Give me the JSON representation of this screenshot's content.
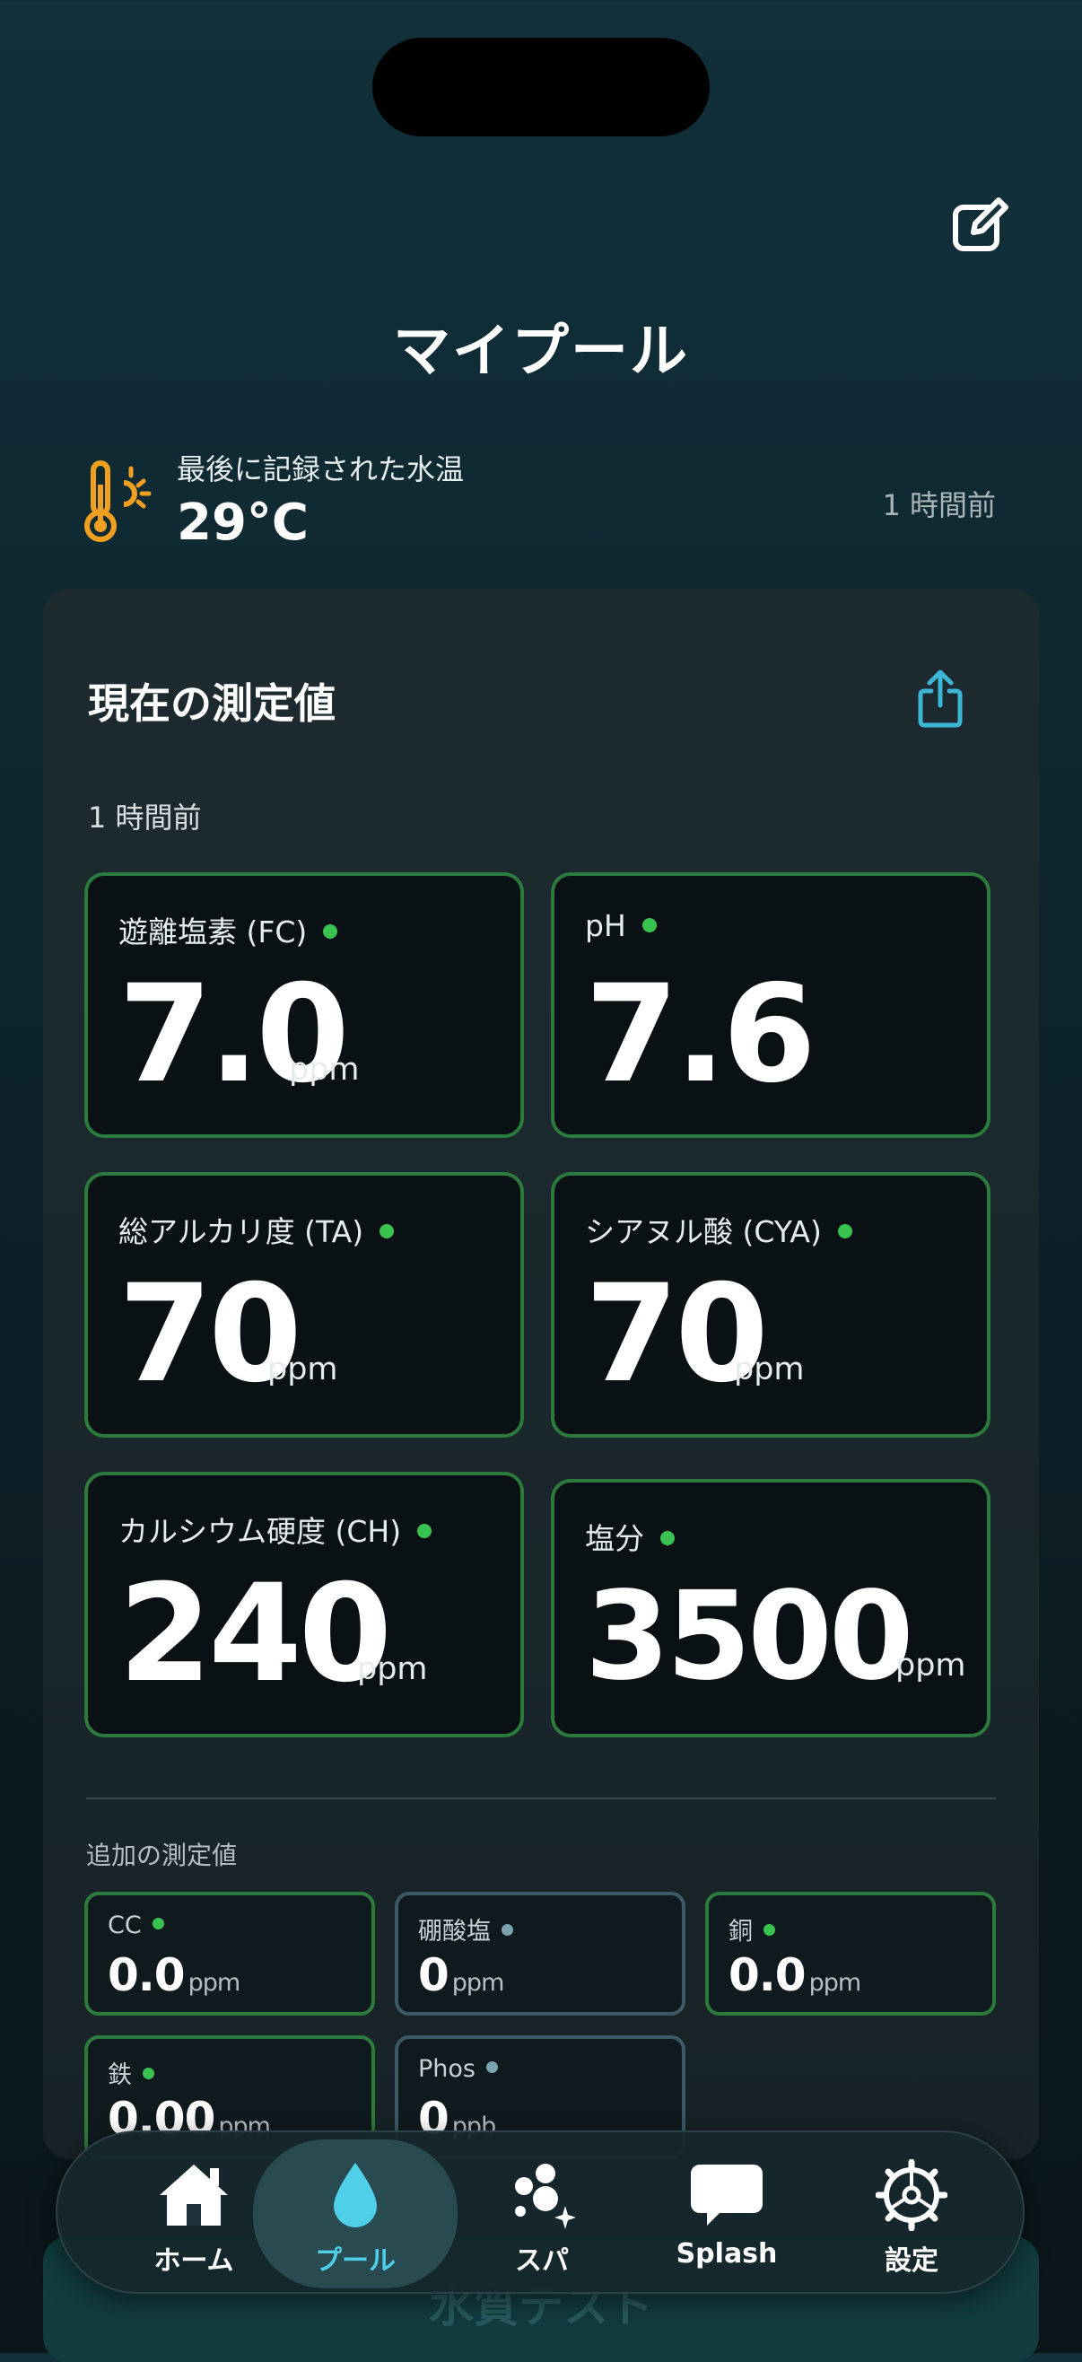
{
  "header": {
    "title": "マイプール"
  },
  "water_temp": {
    "label": "最後に記録された水温",
    "value": "29°C",
    "time": "1 時間前"
  },
  "current": {
    "title": "現在の測定値",
    "time": "1 時間前",
    "metrics": [
      {
        "name": "遊離塩素 (FC)",
        "value": "7.0",
        "unit": "ppm"
      },
      {
        "name": "pH",
        "value": "7.6",
        "unit": ""
      },
      {
        "name": "総アルカリ度 (TA)",
        "value": "70",
        "unit": "ppm"
      },
      {
        "name": "シアヌル酸 (CYA)",
        "value": "70",
        "unit": "ppm"
      },
      {
        "name": "カルシウム硬度 (CH)",
        "value": "240",
        "unit": "ppm"
      },
      {
        "name": "塩分",
        "value": "3500",
        "unit": "ppm"
      }
    ]
  },
  "additional": {
    "title": "追加の測定値",
    "items": [
      {
        "name": "CC",
        "value": "0.0",
        "unit": "ppm"
      },
      {
        "name": "硼酸塩",
        "value": "0",
        "unit": "ppm"
      },
      {
        "name": "銅",
        "value": "0.0",
        "unit": "ppm"
      },
      {
        "name": "鉄",
        "value": "0.00",
        "unit": "ppm"
      },
      {
        "name": "Phos",
        "value": "0",
        "unit": "ppb"
      }
    ]
  },
  "bottom_button": {
    "label": "水質テスト"
  },
  "tabs": [
    {
      "label": "ホーム",
      "icon": "home-icon"
    },
    {
      "label": "プール",
      "icon": "water-drop-icon"
    },
    {
      "label": "スパ",
      "icon": "bubbles-icon"
    },
    {
      "label": "Splash",
      "icon": "chat-bubble-icon"
    },
    {
      "label": "設定",
      "icon": "gear-icon"
    }
  ],
  "colors": {
    "accent": "#4fcfe8",
    "status_ok": "#38c24f",
    "border_ok": "#2c7a3e",
    "temp_icon": "#f0a020"
  }
}
